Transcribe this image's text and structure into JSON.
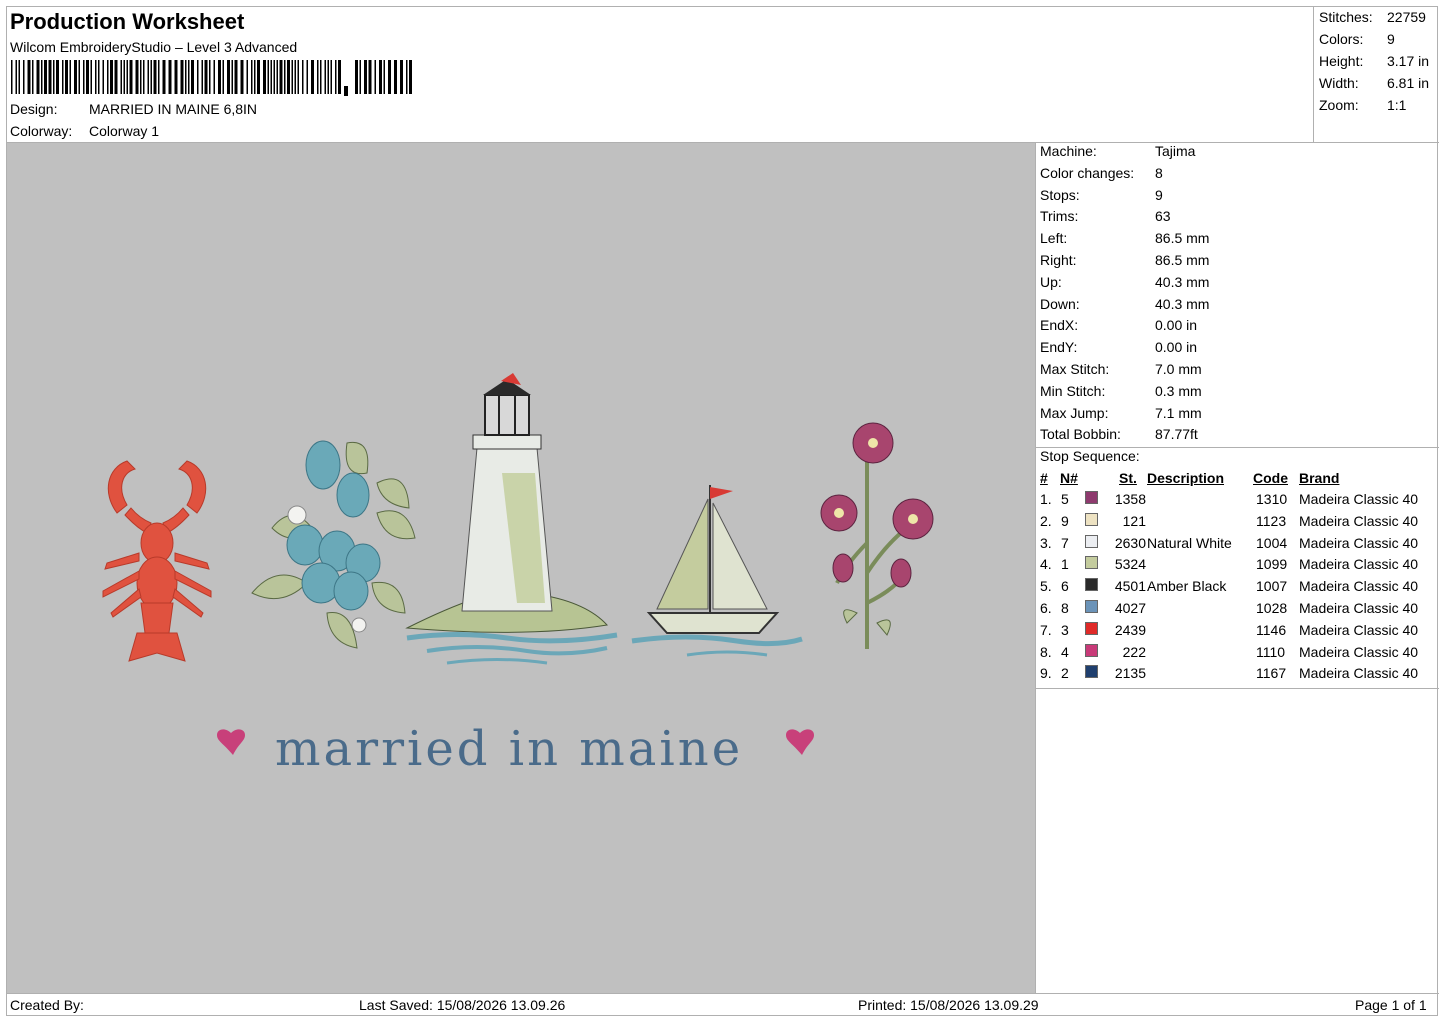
{
  "header": {
    "title": "Production Worksheet",
    "subtitle": "Wilcom EmbroideryStudio – Level 3 Advanced",
    "design_label": "Design:",
    "design_value": "MARRIED IN MAINE 6,8IN",
    "colorway_label": "Colorway:",
    "colorway_value": "Colorway 1"
  },
  "stats": [
    {
      "label": "Stitches:",
      "value": "22759"
    },
    {
      "label": "Colors:",
      "value": "9"
    },
    {
      "label": "Height:",
      "value": "3.17 in"
    },
    {
      "label": "Width:",
      "value": "6.81 in"
    },
    {
      "label": "Zoom:",
      "value": "1:1"
    }
  ],
  "machine_info": [
    {
      "label": "Machine:",
      "value": "Tajima"
    },
    {
      "label": "Color changes:",
      "value": "8"
    },
    {
      "label": "Stops:",
      "value": "9"
    },
    {
      "label": "Trims:",
      "value": "63"
    },
    {
      "label": "Left:",
      "value": "86.5 mm"
    },
    {
      "label": "Right:",
      "value": "86.5 mm"
    },
    {
      "label": "Up:",
      "value": "40.3 mm"
    },
    {
      "label": "Down:",
      "value": "40.3 mm"
    },
    {
      "label": "EndX:",
      "value": "0.00 in"
    },
    {
      "label": "EndY:",
      "value": "0.00 in"
    },
    {
      "label": "Max Stitch:",
      "value": "7.0 mm"
    },
    {
      "label": "Min Stitch:",
      "value": "0.3 mm"
    },
    {
      "label": "Max Jump:",
      "value": "7.1 mm"
    },
    {
      "label": "Total Bobbin:",
      "value": "87.77ft"
    }
  ],
  "stop_sequence": {
    "title": "Stop Sequence:",
    "headers": {
      "num": "#",
      "n": "N#",
      "st": "St.",
      "desc": "Description",
      "code": "Code",
      "brand": "Brand"
    },
    "rows": [
      {
        "num": "1.",
        "n": "5",
        "color": "#8e3a6e",
        "st": "1358",
        "desc": "",
        "code": "1310",
        "brand": "Madeira Classic 40"
      },
      {
        "num": "2.",
        "n": "9",
        "color": "#ede2c2",
        "st": "121",
        "desc": "",
        "code": "1123",
        "brand": "Madeira Classic 40"
      },
      {
        "num": "3.",
        "n": "7",
        "color": "#eceef2",
        "st": "2630",
        "desc": "Natural White",
        "code": "1004",
        "brand": "Madeira Classic 40"
      },
      {
        "num": "4.",
        "n": "1",
        "color": "#c4cc9e",
        "st": "5324",
        "desc": "",
        "code": "1099",
        "brand": "Madeira Classic 40"
      },
      {
        "num": "5.",
        "n": "6",
        "color": "#2a2a2a",
        "st": "4501",
        "desc": "Amber Black",
        "code": "1007",
        "brand": "Madeira Classic 40"
      },
      {
        "num": "6.",
        "n": "8",
        "color": "#6b93b8",
        "st": "4027",
        "desc": "",
        "code": "1028",
        "brand": "Madeira Classic 40"
      },
      {
        "num": "7.",
        "n": "3",
        "color": "#e02a28",
        "st": "2439",
        "desc": "",
        "code": "1146",
        "brand": "Madeira Classic 40"
      },
      {
        "num": "8.",
        "n": "4",
        "color": "#c83a78",
        "st": "222",
        "desc": "",
        "code": "1110",
        "brand": "Madeira Classic 40"
      },
      {
        "num": "9.",
        "n": "2",
        "color": "#1f3f6e",
        "st": "2135",
        "desc": "",
        "code": "1167",
        "brand": "Madeira Classic 40"
      }
    ]
  },
  "design_text": "married in maine",
  "footer": {
    "created_by": "Created By:",
    "last_saved": "Last Saved: 15/08/2026 13.09.26",
    "printed": "Printed: 15/08/2026 13.09.29",
    "page": "Page 1 of 1"
  }
}
